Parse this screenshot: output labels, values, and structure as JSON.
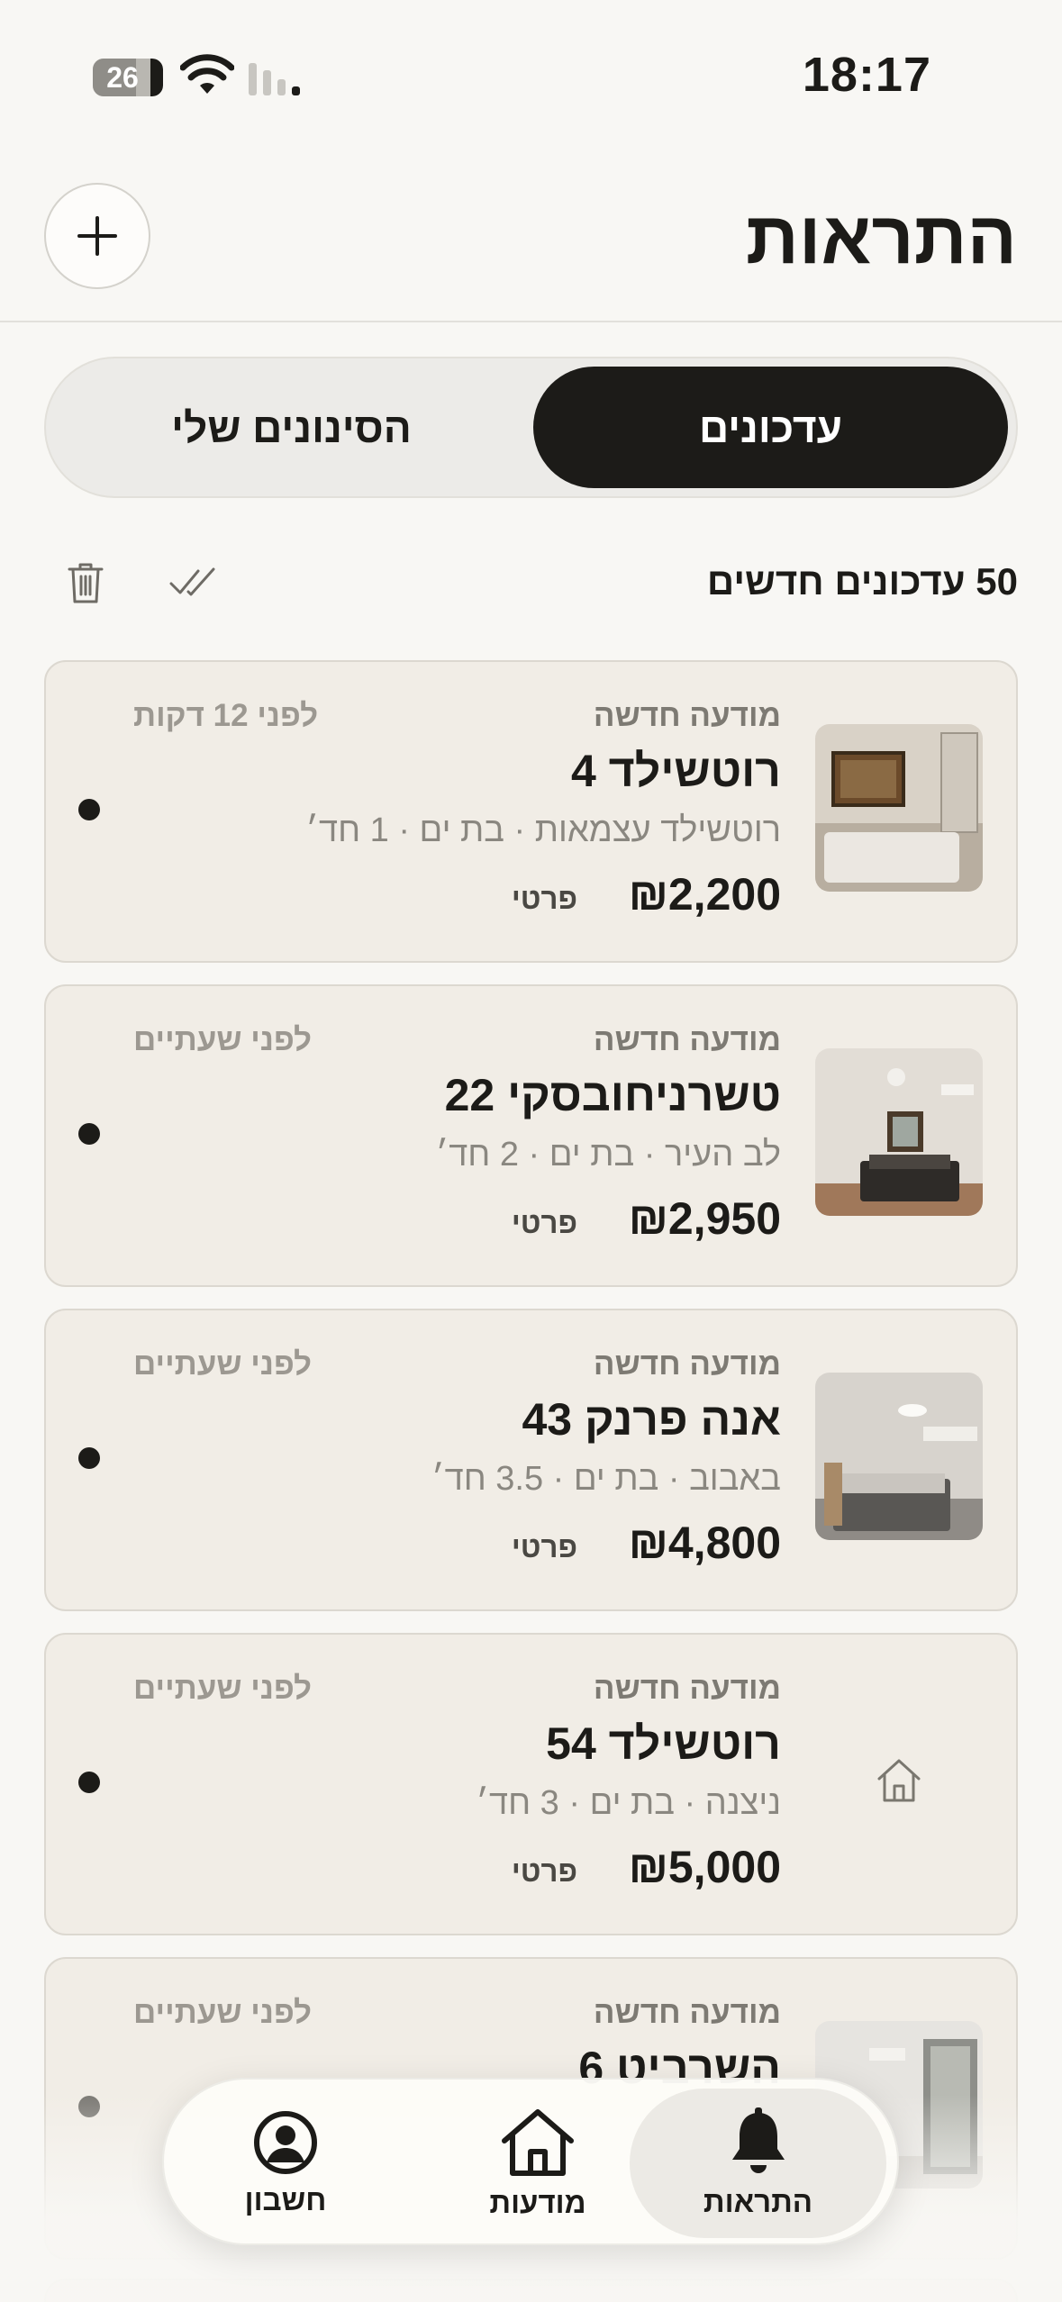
{
  "status_bar": {
    "time": "18:17",
    "battery": "26"
  },
  "header": {
    "title": "התראות"
  },
  "tabs": {
    "active": "עדכונים",
    "inactive": "הסינונים שלי"
  },
  "updates": {
    "count_label": "50 עדכונים חדשים"
  },
  "cards": [
    {
      "label": "מודעה חדשה",
      "time": "לפני 12 דקות",
      "title": "רוטשילד 4",
      "subtitle": "רוטשילד עצמאות · בת ים · 1 חד׳",
      "price": "₪2,200",
      "type": "פרטי",
      "thumbnail": "bedroom-photo"
    },
    {
      "label": "מודעה חדשה",
      "time": "לפני שעתיים",
      "title": "טשרניחובסקי 22",
      "subtitle": "לב העיר · בת ים · 2 חד׳",
      "price": "₪2,950",
      "type": "פרטי",
      "thumbnail": "bedroom-photo"
    },
    {
      "label": "מודעה חדשה",
      "time": "לפני שעתיים",
      "title": "אנה פרנק 43",
      "subtitle": "באבוב · בת ים · 3.5 חד׳",
      "price": "₪4,800",
      "type": "פרטי",
      "thumbnail": "bedroom-photo"
    },
    {
      "label": "מודעה חדשה",
      "time": "לפני שעתיים",
      "title": "רוטשילד 54",
      "subtitle": "ניצנה · בת ים · 3 חד׳",
      "price": "₪5,000",
      "type": "פרטי",
      "thumbnail": "home-icon"
    },
    {
      "label": "מודעה חדשה",
      "time": "לפני שעתיים",
      "title": "השרביט 6",
      "subtitle": "",
      "price": "",
      "type": "",
      "thumbnail": "room-photo"
    }
  ],
  "bottom_nav": {
    "alerts": "התראות",
    "listings": "מודעות",
    "account": "חשבון"
  },
  "colors": {
    "accent": "#1c1b18",
    "card_bg": "#f1ede6",
    "page_bg": "#f8f7f4"
  }
}
